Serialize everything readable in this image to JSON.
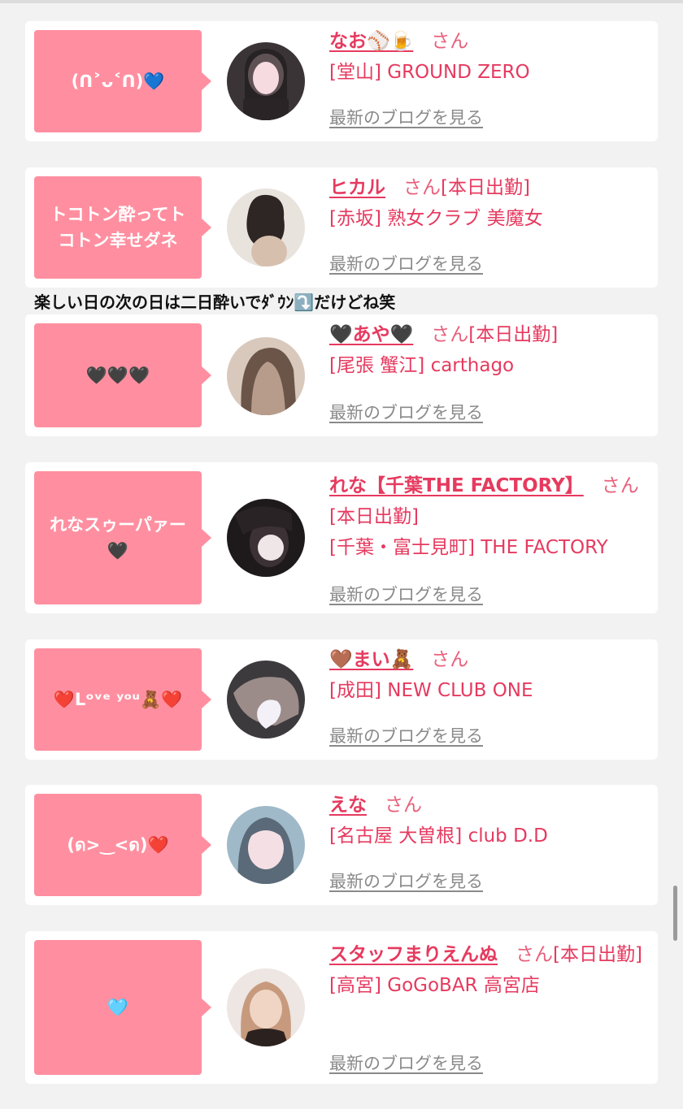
{
  "cards": [
    {
      "bubble": "(ᑎ˃ᴗ˂ᑎ)💙",
      "name": "なお⚾🍺",
      "san": "さん",
      "status": "",
      "shop": "[堂山] GROUND ZERO",
      "blog_link": "最新のブログを見る",
      "avatar_colors": [
        "#3a3436",
        "#f3d2d6",
        "#1f1b1c"
      ]
    },
    {
      "bubble": "トコトン酔ってト\nコトン幸せダネ",
      "name": "ヒカル",
      "san": "さん",
      "status": "[本日出勤]",
      "shop": "[赤坂] 熟女クラブ 美魔女",
      "blog_link": "最新のブログを見る",
      "avatar_colors": [
        "#e9e3de",
        "#2d2624",
        "#d7bfae"
      ]
    },
    {
      "bubble": "🖤🖤🖤",
      "name": "🖤あや🖤",
      "san": "さん",
      "status": "[本日出勤]",
      "shop": "[尾張 蟹江] carthago",
      "blog_link": "最新のブログを見る",
      "avatar_colors": [
        "#b89c8b",
        "#6b5448",
        "#d9c9bd"
      ]
    },
    {
      "bubble": "れなスゥーパァー\n🖤",
      "name": "れな【千葉THE FACTORY】",
      "san": "さん",
      "status": "[本日出勤]",
      "shop": "[千葉・富士見町] THE FACTORY",
      "blog_link": "最新のブログを見る",
      "avatar_colors": [
        "#1e1a1c",
        "#efe6e8",
        "#3c3236"
      ]
    },
    {
      "bubble": "❤️Lᵒᵛᵉ ʸᵒᵘ🧸❤️",
      "name": "🤎まい🧸",
      "san": "さん",
      "status": "",
      "shop": "[成田] NEW CLUB ONE",
      "blog_link": "最新のブログを見る",
      "avatar_colors": [
        "#3d3a3e",
        "#f3f1f7",
        "#9b8c8a"
      ]
    },
    {
      "bubble": "(ด>‿<ด)❤️",
      "name": "えな",
      "san": "さん",
      "status": "",
      "shop": "[名古屋 大曽根] club D.D",
      "blog_link": "最新のブログを見る",
      "avatar_colors": [
        "#9fb9c8",
        "#f4dfe4",
        "#5a6a78"
      ]
    },
    {
      "bubble": "🩵",
      "name": "スタッフまりえんぬ",
      "san": "さん",
      "status": "[本日出勤]",
      "shop": "[高宮] GoGoBAR 高宮店",
      "blog_link": "最新のブログを見る",
      "avatar_colors": [
        "#c79a7e",
        "#f1d5c4",
        "#2b2220"
      ]
    }
  ],
  "caption": "楽しい日の次の日は二日酔いでﾀﾞｳﾝ⤵️だけどね笑"
}
